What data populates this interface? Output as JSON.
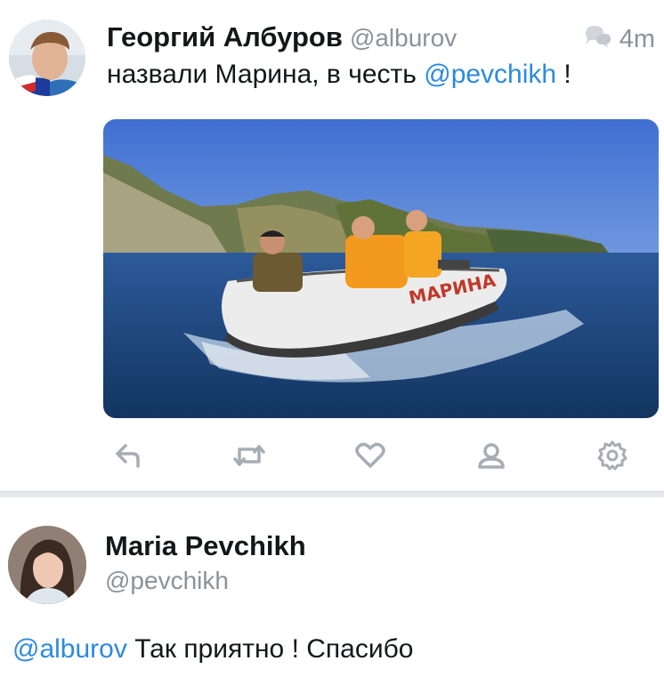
{
  "tweet1": {
    "author_name": "Георгий Албуров",
    "author_handle": "@alburov",
    "time": "4m",
    "text_before": "назвали Марина, в честь ",
    "mention": "@pevchikh",
    "text_after": " !",
    "media": {
      "boat_label": "МАРИНА"
    },
    "actions": [
      "reply-icon",
      "retweet-icon",
      "like-icon",
      "profile-icon",
      "settings-icon"
    ]
  },
  "tweet2": {
    "author_name": "Maria Pevchikh",
    "author_handle": "@pevchikh",
    "mention": "@alburov",
    "text": " Так приятно ! Спасибо"
  },
  "colors": {
    "link": "#2c8ae0",
    "muted": "#8a939b",
    "text": "#14171a"
  }
}
